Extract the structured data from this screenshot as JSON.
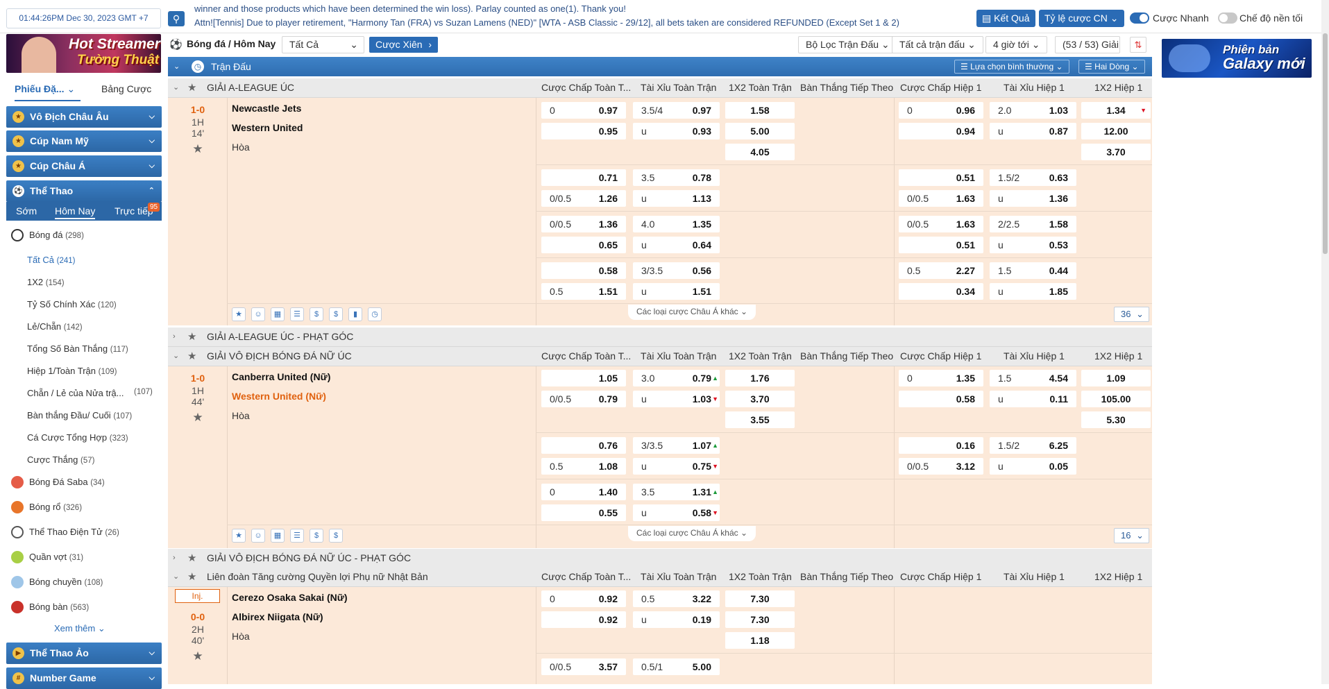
{
  "topbar": {
    "clock": "01:44:26PM Dec 30, 2023 GMT +7",
    "ticker_line1": "winner and those products which have been determined the win loss). Parlay counted as one(1). Thank you!",
    "ticker_line2": "Attn![Tennis] Due to player retirement, \"Harmony Tan (FRA) vs Suzan Lamens (NED)\" [WTA - ASB Classic - 29/12], all bets taken are considered REFUNDED (Except Set 1 & 2)",
    "ket_qua": "Kết Quả",
    "ty_le": "Tỷ lệ cược CN",
    "cuoc_nhanh": "Cược Nhanh",
    "che_do": "Chế độ nền tối"
  },
  "sidebar": {
    "banner_t1": "Hot Streamer",
    "banner_t2": "Tường Thuật",
    "tab_phieu": "Phiếu Đặ...",
    "tab_bang": "Bảng Cược",
    "sections": {
      "vo_dich": "Vô Địch Châu Âu",
      "cup_nam_my": "Cúp Nam Mỹ",
      "cup_chau_a": "Cúp Châu Á",
      "the_thao": "Thể Thao",
      "the_thao_ao": "Thể Thao Ảo",
      "number_game": "Number Game"
    },
    "subtabs": {
      "som": "Sớm",
      "hom_nay": "Hôm Nay",
      "truc_tiep": "Trực tiếp",
      "badge": "95"
    },
    "sports": [
      {
        "name": "Bóng đá",
        "count": "(298)"
      },
      {
        "name": "Bóng Đá Saba",
        "count": "(34)"
      },
      {
        "name": "Bóng rổ",
        "count": "(326)"
      },
      {
        "name": "Thể Thao Điện Tử",
        "count": "(26)"
      },
      {
        "name": "Quần vợt",
        "count": "(31)"
      },
      {
        "name": "Bóng chuyền",
        "count": "(108)"
      },
      {
        "name": "Bóng bàn",
        "count": "(563)"
      }
    ],
    "subitems": [
      {
        "name": "Tất Cả",
        "count": "(241)"
      },
      {
        "name": "1X2",
        "count": "(154)"
      },
      {
        "name": "Tỷ Số Chính Xác",
        "count": "(120)"
      },
      {
        "name": "Lẻ/Chẵn",
        "count": "(142)"
      },
      {
        "name": "Tổng Số Bàn Thắng",
        "count": "(117)"
      },
      {
        "name": "Hiệp 1/Toàn Trận",
        "count": "(109)"
      },
      {
        "name": "Chẵn / Lẻ của Nửa trậ...",
        "count": "(107)"
      },
      {
        "name": "Bàn thắng Đầu/ Cuối",
        "count": "(107)"
      },
      {
        "name": "Cá Cược Tổng Hợp",
        "count": "(323)"
      },
      {
        "name": "Cược Thắng",
        "count": "(57)"
      }
    ],
    "xem_them": "Xem thêm"
  },
  "filters": {
    "breadcrumb": "Bóng đá / Hôm Nay",
    "select": "Tất Cả",
    "cuoc_xien": "Cược Xiên",
    "bo_loc": "Bộ Lọc Trận Đấu",
    "tat_ca_tran": "Tất cả trận đấu",
    "gio_toi": "4 giờ tới",
    "giai": "(53 / 53) Giải"
  },
  "table": {
    "title": "Trận Đấu",
    "lua_chon": "Lựa chọn bình thường",
    "hai_dong": "Hai Dòng",
    "cols": [
      "Cược Chấp Toàn T...",
      "Tài Xỉu Toàn Trận",
      "1X2 Toàn Trận",
      "Bàn Thắng Tiếp Theo",
      "Cược Chấp Hiệp 1",
      "Tài Xỉu Hiệp 1",
      "1X2 Hiệp 1"
    ],
    "more_label": "Các loại cược Châu Á khác",
    "draw": "Hòa"
  },
  "leagues": {
    "l1": "GIẢI A-LEAGUE ÚC",
    "l2": "GIẢI A-LEAGUE ÚC - PHẠT GÓC",
    "l3": "GIẢI VÔ ĐỊCH BÓNG ĐÁ NỮ ÚC",
    "l4": "GIẢI VÔ ĐỊCH BÓNG ĐÁ NỮ ÚC - PHẠT GÓC",
    "l5": "Liên đoàn Tăng cường Quyền lợi Phụ nữ Nhật Bản"
  },
  "m1": {
    "score": "1-0",
    "half": "1H",
    "min": "14'",
    "home": "Newcastle Jets",
    "away": "Western United",
    "pager": "36",
    "r1": [
      "0",
      "0.97",
      "3.5/4",
      "0.97",
      "1.58",
      "0",
      "0.96",
      "2.0",
      "1.03",
      "1.34"
    ],
    "r2": [
      "",
      "0.95",
      "u",
      "0.93",
      "5.00",
      "",
      "0.94",
      "u",
      "0.87",
      "12.00"
    ],
    "r3": [
      "4.05",
      "3.70"
    ],
    "b1": [
      "",
      "0.71",
      "3.5",
      "0.78",
      "",
      "0.51",
      "1.5/2",
      "0.63"
    ],
    "b2": [
      "0/0.5",
      "1.26",
      "u",
      "1.13",
      "0/0.5",
      "1.63",
      "u",
      "1.36"
    ],
    "b3": [
      "0/0.5",
      "1.36",
      "4.0",
      "1.35",
      "0/0.5",
      "1.63",
      "2/2.5",
      "1.58"
    ],
    "b4": [
      "",
      "0.65",
      "u",
      "0.64",
      "",
      "0.51",
      "u",
      "0.53"
    ],
    "b5": [
      "",
      "0.58",
      "3/3.5",
      "0.56",
      "0.5",
      "2.27",
      "1.5",
      "0.44"
    ],
    "b6": [
      "0.5",
      "1.51",
      "u",
      "1.51",
      "",
      "0.34",
      "u",
      "1.85"
    ]
  },
  "m2": {
    "score": "1-0",
    "half": "1H",
    "min": "44'",
    "home": "Canberra United (Nữ)",
    "away": "Western United (Nữ)",
    "pager": "16",
    "r1": [
      "",
      "1.05",
      "3.0",
      "0.79",
      "1.76",
      "0",
      "1.35",
      "1.5",
      "4.54",
      "1.09"
    ],
    "r2": [
      "0/0.5",
      "0.79",
      "u",
      "1.03",
      "3.70",
      "",
      "0.58",
      "u",
      "0.11",
      "105.00"
    ],
    "r3": [
      "3.55",
      "5.30"
    ],
    "b1": [
      "",
      "0.76",
      "3/3.5",
      "1.07",
      "",
      "0.16",
      "1.5/2",
      "6.25"
    ],
    "b2": [
      "0.5",
      "1.08",
      "u",
      "0.75",
      "0/0.5",
      "3.12",
      "u",
      "0.05"
    ],
    "b3": [
      "0",
      "1.40",
      "3.5",
      "1.31"
    ],
    "b4": [
      "",
      "0.55",
      "u",
      "0.58"
    ]
  },
  "m3": {
    "inj": "Inj.",
    "score": "0-0",
    "half": "2H",
    "min": "40'",
    "home": "Cerezo Osaka Sakai (Nữ)",
    "away": "Albirex Niigata (Nữ)",
    "r1": [
      "0",
      "0.92",
      "0.5",
      "3.22",
      "7.30"
    ],
    "r2": [
      "",
      "0.92",
      "u",
      "0.19",
      "7.30"
    ],
    "r3": [
      "1.18"
    ],
    "b1": [
      "0/0.5",
      "3.57",
      "0.5/1",
      "5.00"
    ]
  },
  "galaxy": {
    "t1": "Phiên bản",
    "t2": "Galaxy mới"
  }
}
